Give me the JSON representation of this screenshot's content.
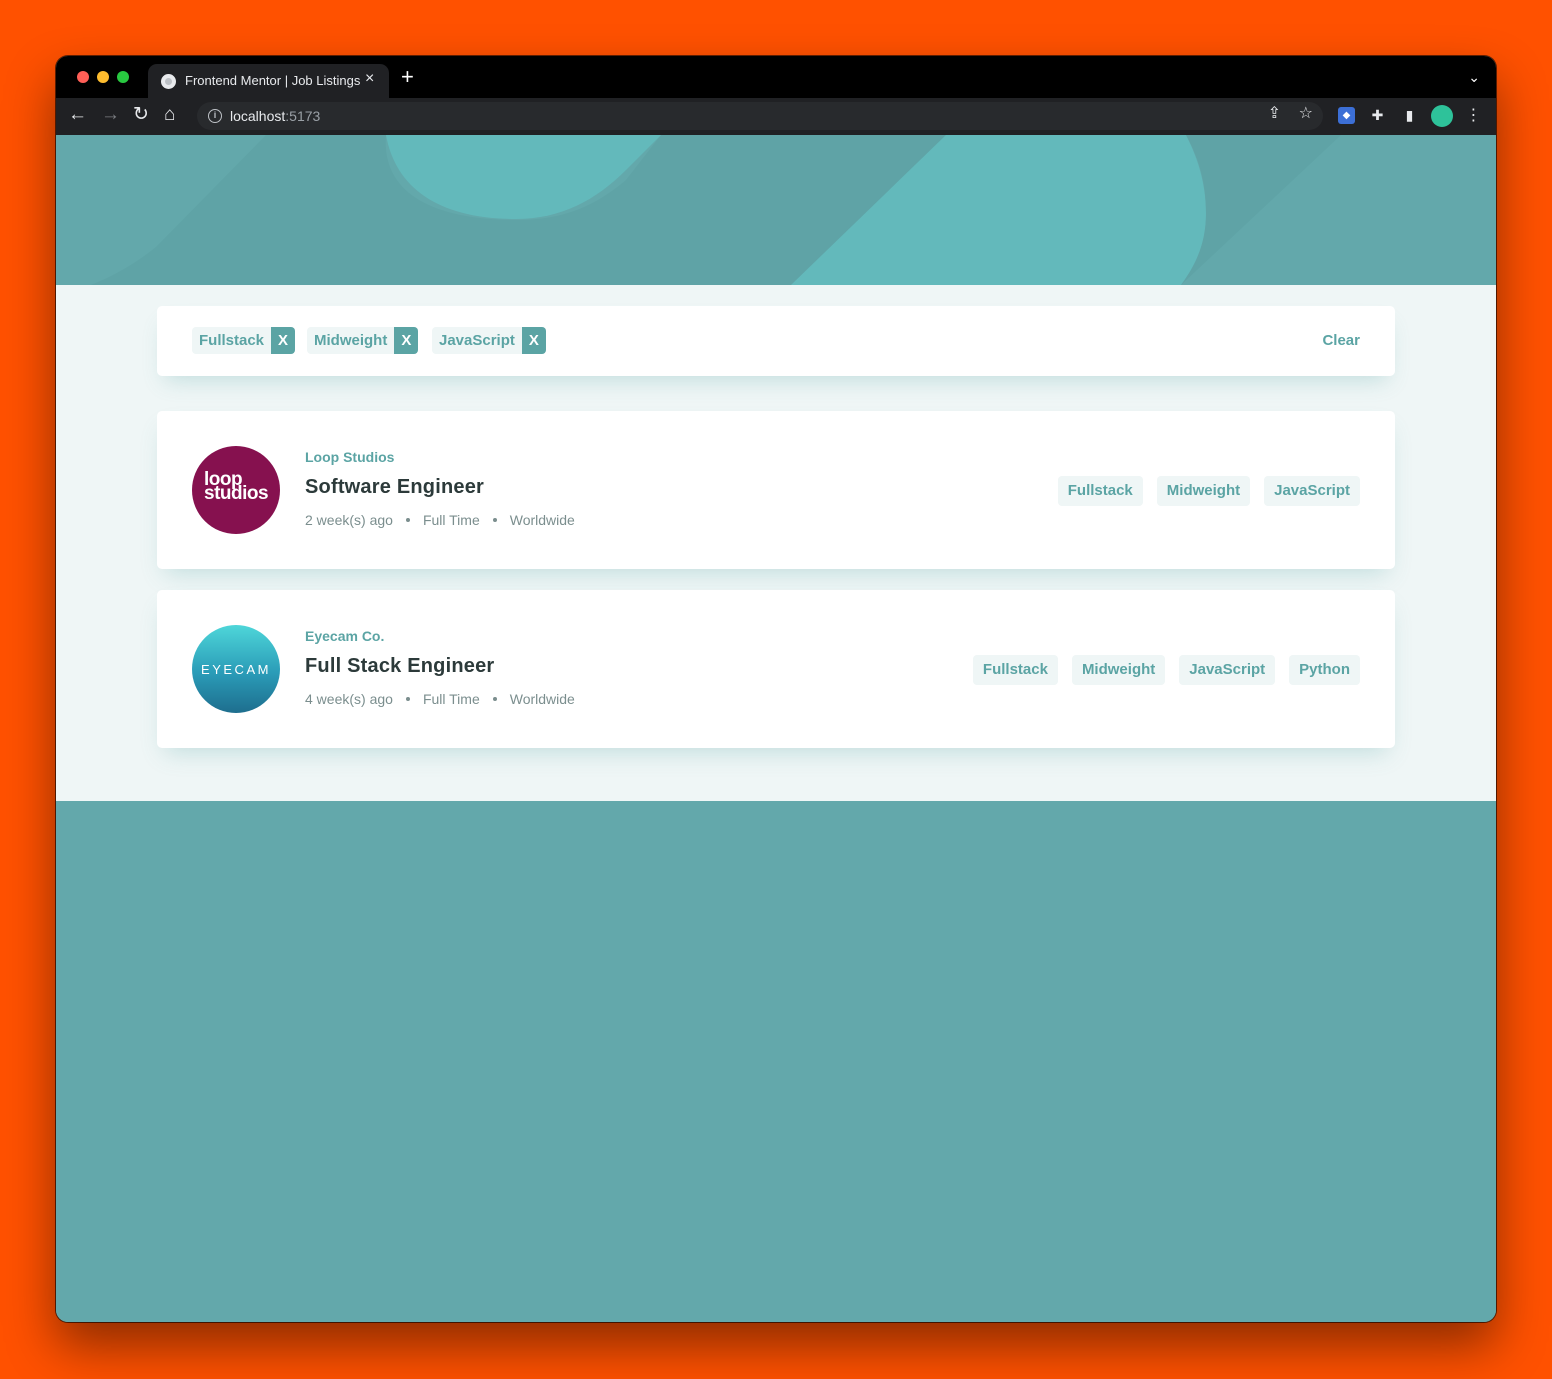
{
  "browser": {
    "tab_title": "Frontend Mentor | Job Listings",
    "url_host": "localhost",
    "url_port": ":5173"
  },
  "theme": {
    "primary": "#5BA4A4",
    "background": "#EFF6F6",
    "header": "#63A8AB",
    "outer": "#FF5100"
  },
  "filters": {
    "items": [
      "Fullstack",
      "Midweight",
      "JavaScript"
    ],
    "remove_label": "X",
    "clear_label": "Clear"
  },
  "jobs": [
    {
      "company": "Loop Studios",
      "logo_text": [
        "loop",
        "studios"
      ],
      "position": "Software Engineer",
      "posted": "2 week(s) ago",
      "contract": "Full Time",
      "location": "Worldwide",
      "tags": [
        "Fullstack",
        "Midweight",
        "JavaScript"
      ]
    },
    {
      "company": "Eyecam Co.",
      "logo_text": [
        "EYECAM"
      ],
      "position": "Full Stack Engineer",
      "posted": "4 week(s) ago",
      "contract": "Full Time",
      "location": "Worldwide",
      "tags": [
        "Fullstack",
        "Midweight",
        "JavaScript",
        "Python"
      ]
    }
  ]
}
